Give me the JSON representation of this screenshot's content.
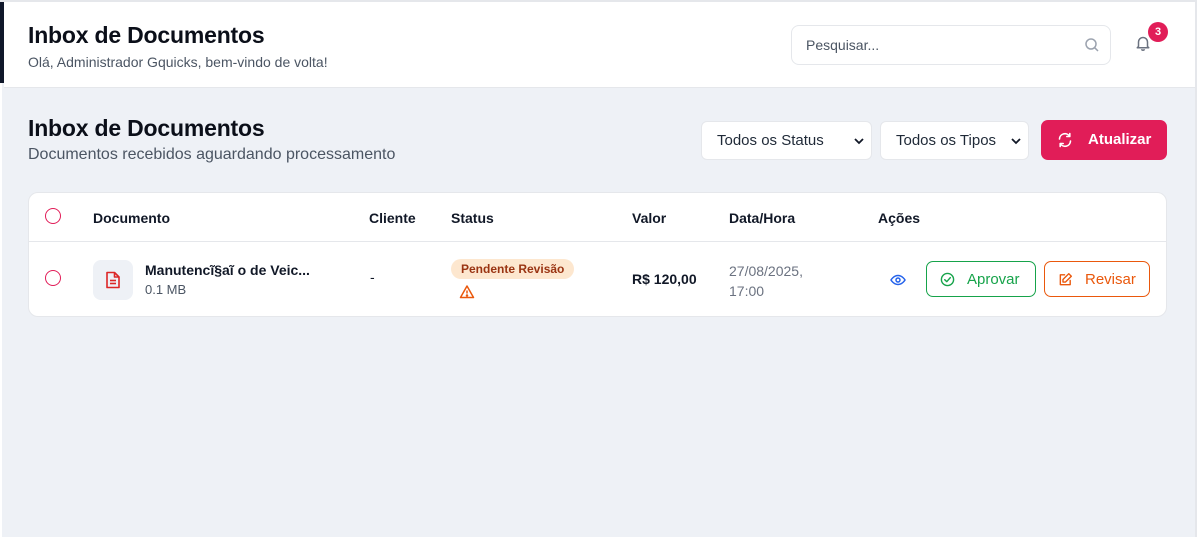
{
  "header": {
    "title": "Inbox de Documentos",
    "subtitle": "Olá, Administrador Gquicks, bem-vindo de volta!",
    "search_placeholder": "Pesquisar...",
    "notification_count": "3"
  },
  "section": {
    "title": "Inbox de Documentos",
    "subtitle": "Documentos recebidos aguardando processamento",
    "status_filter": "Todos os Status",
    "type_filter": "Todos os Tipos",
    "refresh_label": "Atualizar"
  },
  "table": {
    "columns": [
      "Documento",
      "Cliente",
      "Status",
      "Valor",
      "Data/Hora",
      "Ações"
    ],
    "rows": [
      {
        "name": "Manutencĩ§aĩ  o de Veic...",
        "size": "0.1 MB",
        "client": "-",
        "status": "Pendente Revisão",
        "value": "R$ 120,00",
        "date": "27/08/2025,",
        "time": "17:00",
        "approve_label": "Aprovar",
        "review_label": "Revisar"
      }
    ]
  },
  "colors": {
    "accent": "#e11d58",
    "approve": "#16a34a",
    "review": "#ea580c",
    "status_bg": "#fde7cf",
    "status_text": "#9a3412"
  },
  "icons": {
    "search": "search-icon",
    "bell": "bell-icon",
    "refresh": "refresh-icon",
    "document": "document-icon",
    "warning": "warning-icon",
    "view": "eye-icon",
    "approve": "check-circle-icon",
    "review": "edit-icon"
  }
}
